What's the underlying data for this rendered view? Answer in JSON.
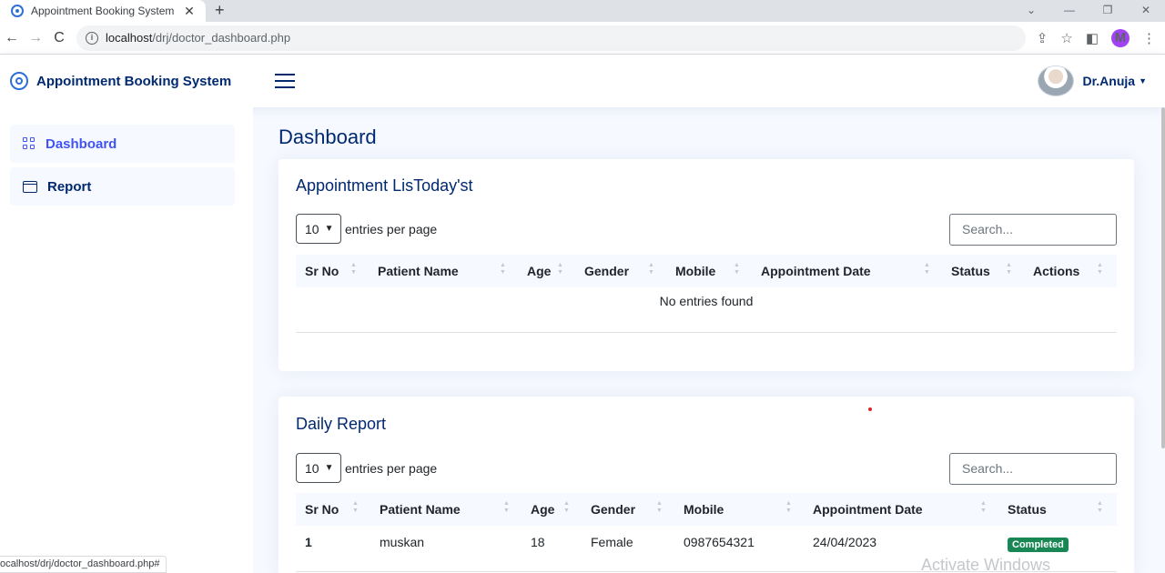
{
  "browser": {
    "tab_title": "Appointment Booking System",
    "tab_close": "✕",
    "new_tab": "+",
    "url_host": "localhost",
    "url_path": "/drj/doctor_dashboard.php",
    "profile_initial": "M",
    "status_url": "ocalhost/drj/doctor_dashboard.php#"
  },
  "header": {
    "brand": "Appointment Booking System",
    "user_name": "Dr.Anuja"
  },
  "sidebar": {
    "items": [
      {
        "label": "Dashboard",
        "icon": "grid-icon",
        "active": true
      },
      {
        "label": "Report",
        "icon": "calendar-icon",
        "active": false
      }
    ]
  },
  "main": {
    "page_title": "Dashboard",
    "appointments": {
      "title": "Appointment LisToday'st",
      "per_page": "10",
      "entries_label": "entries per page",
      "search_placeholder": "Search...",
      "columns": [
        "Sr No",
        "Patient Name",
        "Age",
        "Gender",
        "Mobile",
        "Appointment Date",
        "Status",
        "Actions"
      ],
      "empty_message": "No entries found"
    },
    "daily_report": {
      "title": "Daily Report",
      "per_page": "10",
      "entries_label": "entries per page",
      "search_placeholder": "Search...",
      "columns": [
        "Sr No",
        "Patient Name",
        "Age",
        "Gender",
        "Mobile",
        "Appointment Date",
        "Status"
      ],
      "rows": [
        {
          "sr_no": "1",
          "patient_name": "muskan",
          "age": "18",
          "gender": "Female",
          "mobile": "0987654321",
          "appointment_date": "24/04/2023",
          "status": "Completed"
        }
      ]
    }
  },
  "watermark": "Activate Windows",
  "colors": {
    "brand": "#012970",
    "accent": "#4154f1",
    "success": "#198754",
    "page_bg": "#f6f9ff"
  }
}
